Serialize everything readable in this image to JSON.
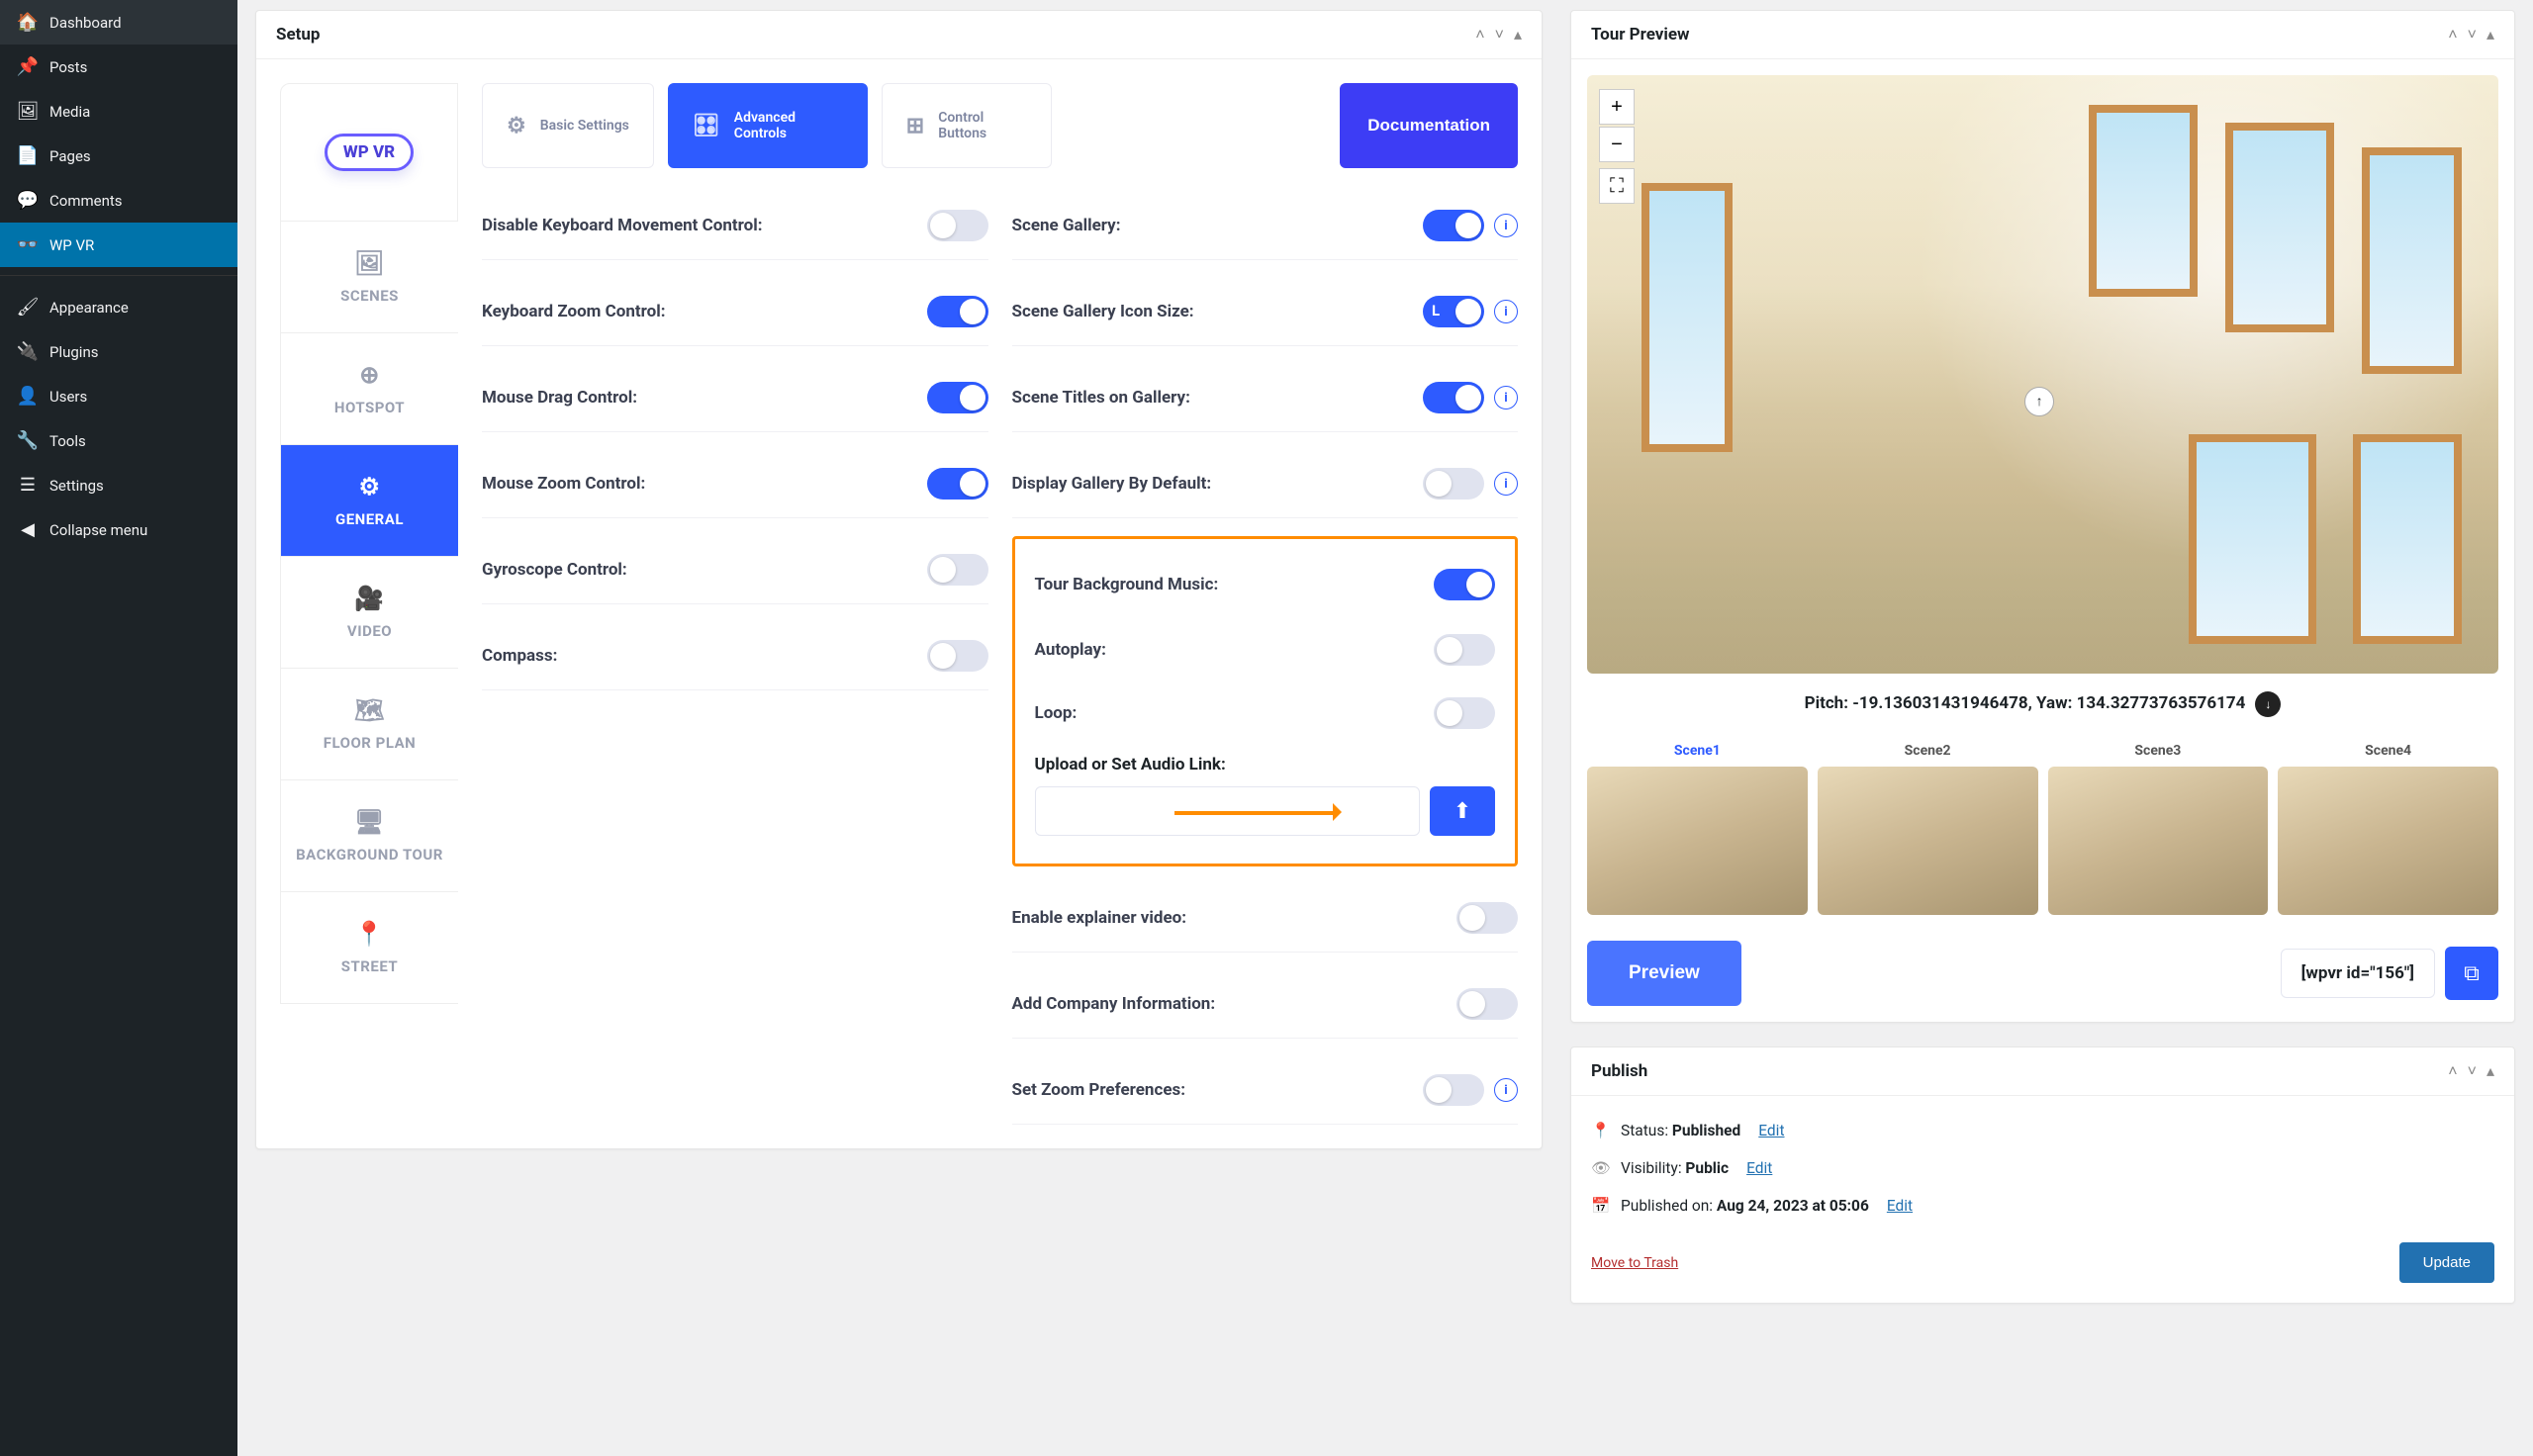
{
  "sidebar": {
    "items": [
      {
        "label": "Dashboard",
        "icon": "⌂"
      },
      {
        "label": "Posts",
        "icon": "📌"
      },
      {
        "label": "Media",
        "icon": "🖼"
      },
      {
        "label": "Pages",
        "icon": "🗐"
      },
      {
        "label": "Comments",
        "icon": "💬"
      },
      {
        "label": "WP VR",
        "icon": "👓"
      }
    ],
    "items2": [
      {
        "label": "Appearance",
        "icon": "🖌"
      },
      {
        "label": "Plugins",
        "icon": "🔌"
      },
      {
        "label": "Users",
        "icon": "👤"
      },
      {
        "label": "Tools",
        "icon": "🔧"
      },
      {
        "label": "Settings",
        "icon": "⚙"
      }
    ],
    "collapse": "Collapse menu"
  },
  "setup": {
    "title": "Setup",
    "logo": "WP VR",
    "vtabs": [
      "SCENES",
      "HOTSPOT",
      "GENERAL",
      "VIDEO",
      "FLOOR PLAN",
      "BACKGROUND TOUR",
      "STREET"
    ],
    "ttabs": {
      "basic": "Basic Settings",
      "advanced": "Advanced Controls",
      "control": "Control Buttons"
    },
    "doc_btn": "Documentation",
    "left": {
      "disable_kb": "Disable Keyboard Movement Control:",
      "kb_zoom": "Keyboard Zoom Control:",
      "mouse_drag": "Mouse Drag Control:",
      "mouse_zoom": "Mouse Zoom Control:",
      "gyro": "Gyroscope Control:",
      "compass": "Compass:"
    },
    "right": {
      "scene_gallery": "Scene Gallery:",
      "icon_size": "Scene Gallery Icon Size:",
      "icon_size_value": "L",
      "titles_gallery": "Scene Titles on Gallery:",
      "display_default": "Display Gallery By Default:",
      "bg_music": "Tour Background Music:",
      "autoplay": "Autoplay:",
      "loop": "Loop:",
      "upload_audio": "Upload or Set Audio Link:",
      "explainer": "Enable explainer video:",
      "company": "Add Company Information:",
      "zoom_pref": "Set Zoom Preferences:"
    }
  },
  "preview": {
    "title": "Tour Preview",
    "info": "Pitch: -19.136031431946478, Yaw: 134.32773763576174",
    "scenes": [
      "Scene1",
      "Scene2",
      "Scene3",
      "Scene4"
    ],
    "preview_btn": "Preview",
    "shortcode": "[wpvr id=\"156\"]"
  },
  "publish": {
    "title": "Publish",
    "status_label": "Status: ",
    "status_value": "Published",
    "visibility_label": "Visibility: ",
    "visibility_value": "Public",
    "publishedon_label": "Published on: ",
    "publishedon_value": "Aug 24, 2023 at 05:06",
    "edit": "Edit",
    "trash": "Move to Trash",
    "update": "Update"
  }
}
